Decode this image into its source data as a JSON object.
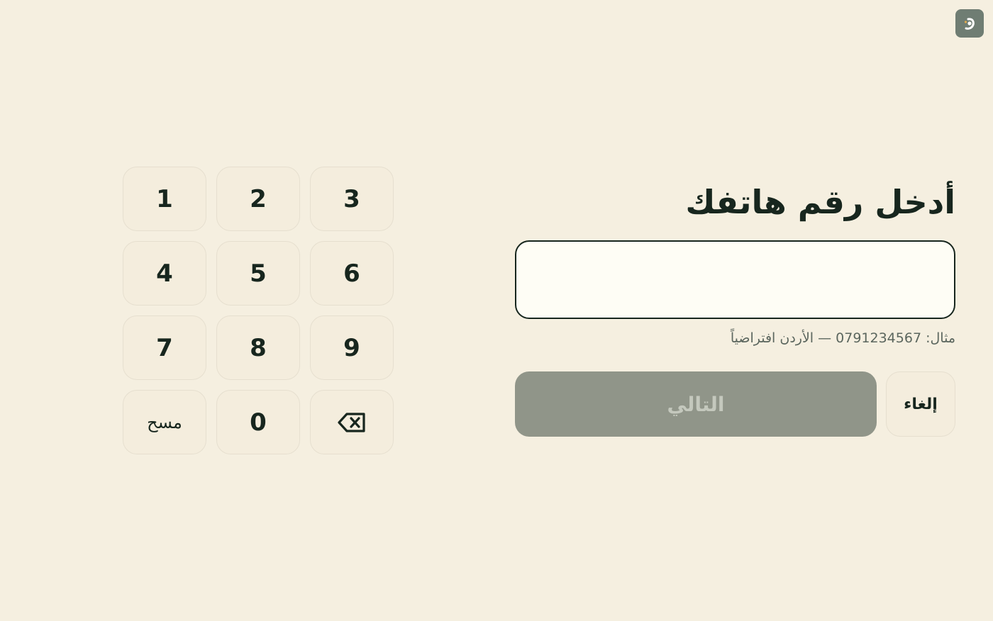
{
  "logo": {
    "icon": "brand-logo-icon"
  },
  "keypad": {
    "keys": [
      {
        "label": "1"
      },
      {
        "label": "2"
      },
      {
        "label": "3"
      },
      {
        "label": "4"
      },
      {
        "label": "5"
      },
      {
        "label": "6"
      },
      {
        "label": "7"
      },
      {
        "label": "8"
      },
      {
        "label": "9"
      },
      {
        "label": "مسح"
      },
      {
        "label": "0"
      },
      {
        "icon": "backspace-icon"
      }
    ]
  },
  "form": {
    "title": "أدخل رقم هاتفك",
    "phone_value": "",
    "hint": "مثال: 0791234567 — الأردن افتراضياً",
    "next_label": "التالي",
    "cancel_label": "إلغاء"
  },
  "colors": {
    "background": "#f5efe0",
    "text": "#17261e",
    "disabled_button": "#909589",
    "logo_bg": "#6f7d73",
    "logo_accent": "#e0a94e"
  }
}
